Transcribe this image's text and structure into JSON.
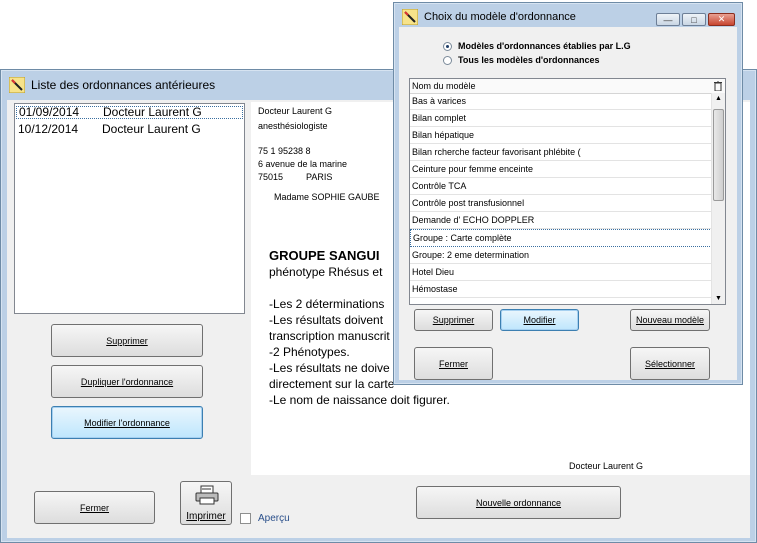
{
  "main_window": {
    "title": "Liste des ordonnances antérieures",
    "list": [
      {
        "date": "01/09/2014",
        "doctor": "Docteur Laurent G"
      },
      {
        "date": "10/12/2014",
        "doctor": "Docteur Laurent G"
      }
    ],
    "buttons": {
      "supprimer": "Supprimer",
      "dupliquer": "Dupliquer l'ordonnance",
      "modifier": "Modifier l'ordonnance",
      "fermer": "Fermer",
      "imprimer": "Imprimer",
      "apercu": "Aperçu",
      "nouvelle": "Nouvelle ordonnance"
    },
    "preview": {
      "doctor_name": "Docteur Laurent G",
      "specialty": "anesthésiologiste",
      "id_number": "75 1 95238 8",
      "address1": "6 avenue de la marine",
      "postal": "75015",
      "city": "PARIS",
      "patient": "Madame SOPHIE GAUBE",
      "heading": "GROUPE  SANGUI",
      "line1": "phénotype Rhésus et",
      "line2": "-Les 2 déterminations",
      "line3": "-Les résultats doivent",
      "line4": "transcription manuscrit",
      "line5": "-2 Phénotypes.",
      "line6": "-Les résultats ne doive",
      "line7": "directement sur la carte",
      "line8": "-Le nom de naissance doit figurer.",
      "signature": "Docteur Laurent G"
    }
  },
  "dialog": {
    "title": "Choix du modèle d'ordonnance",
    "radio1": "Modèles d'ordonnances établies par L.G",
    "radio2": "Tous les modèles d'ordonnances",
    "column_header": "Nom du modèle",
    "items": [
      "Bas à varices",
      "Bilan complet",
      "Bilan hépatique",
      "Bilan rcherche facteur favorisant phlébite (",
      "Ceinture pour femme enceinte",
      "Contrôle TCA",
      "Contrôle post transfusionnel",
      "Demande d' ECHO DOPPLER",
      "Groupe : Carte complète",
      "Groupe: 2 eme determination",
      "Hotel Dieu",
      "Hémostase"
    ],
    "buttons": {
      "supprimer": "Supprimer",
      "modifier": "Modifier",
      "nouveau": "Nouveau modèle",
      "fermer": "Fermer",
      "selectionner": "Sélectionner"
    }
  }
}
